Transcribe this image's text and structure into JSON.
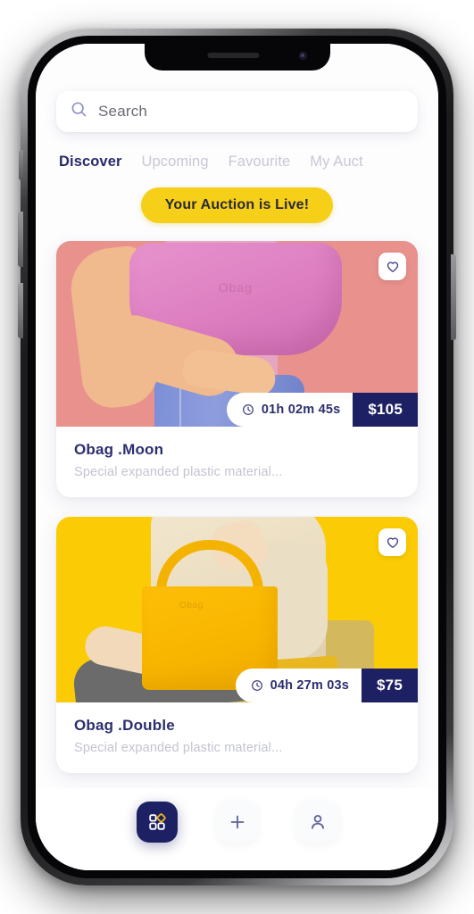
{
  "app": {
    "search": {
      "icon": "search-icon",
      "placeholder": "Search",
      "value": ""
    },
    "tabs": [
      {
        "label": "Discover",
        "active": true
      },
      {
        "label": "Upcoming",
        "active": false
      },
      {
        "label": "Favourite",
        "active": false
      },
      {
        "label": "My Auct",
        "active": false
      }
    ],
    "live_banner": {
      "label": "Your Auction is Live!",
      "background": "#f5cf18",
      "text_color": "#2a2a33"
    },
    "cards": [
      {
        "title": "Obag .Moon",
        "subtitle": "Special expanded plastic material...",
        "timer": "01h 02m 45s",
        "price": "$105",
        "timer_icon": "clock-icon",
        "favourite_icon": "heart-outline-icon",
        "image_alt": "woman-holding-pink-obag",
        "image_bg": "#e8918d",
        "bag_color": "#dd7ec1",
        "bag_logo": "Obag"
      },
      {
        "title": "Obag .Double",
        "subtitle": "Special expanded plastic material...",
        "timer": "04h 27m 03s",
        "price": "$75",
        "timer_icon": "clock-icon",
        "favourite_icon": "heart-outline-icon",
        "image_alt": "woman-seated-with-yellow-obag-tote",
        "image_bg": "#fbcc05",
        "bag_color": "#f8b500",
        "bag_logo": "Obag"
      }
    ],
    "bottom_nav": [
      {
        "icon": "grid-apps-icon",
        "active": true,
        "label": ""
      },
      {
        "icon": "plus-icon",
        "active": false,
        "label": ""
      },
      {
        "icon": "person-icon",
        "active": false,
        "label": ""
      }
    ],
    "colors": {
      "navy": "#1d2163",
      "navy_text": "#2c2f6e",
      "accent_yellow": "#f5cf18",
      "muted": "#c3c4d0"
    }
  }
}
